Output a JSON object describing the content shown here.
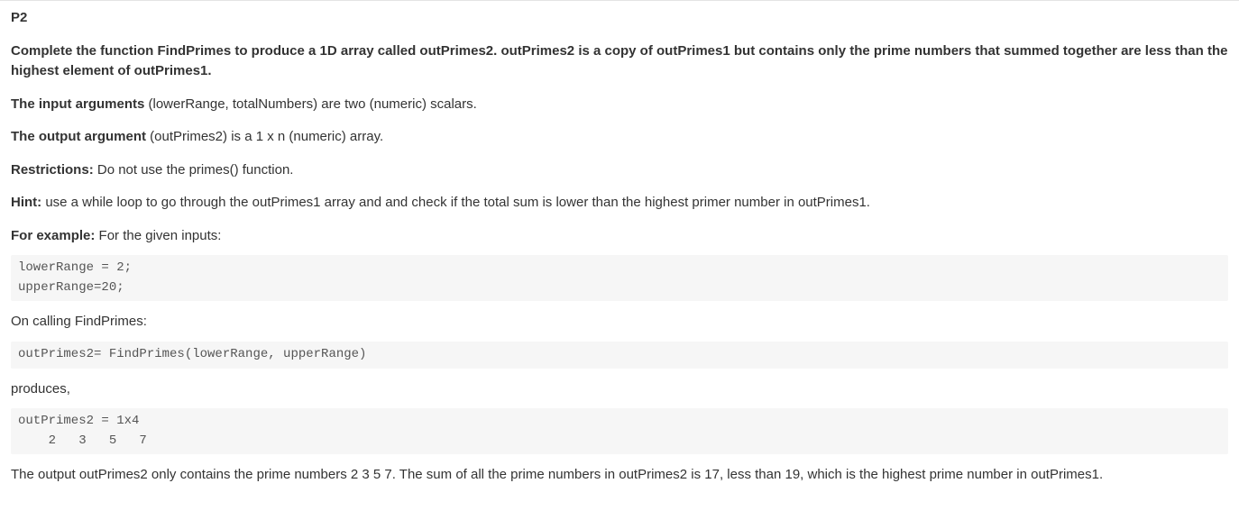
{
  "heading": "P2",
  "intro": {
    "bold": "Complete the function FindPrimes to produce a 1D array called outPrimes2.  outPrimes2 is a copy of outPrimes1 but contains only the prime numbers that summed together are less than the highest element of outPrimes1."
  },
  "input_args": {
    "label": "The input arguments",
    "rest": " (lowerRange, totalNumbers) are two (numeric) scalars."
  },
  "output_arg": {
    "label": "The output argument",
    "rest": " (outPrimes2) is a 1 x n (numeric) array."
  },
  "restrictions": {
    "label": "Restrictions:",
    "rest": " Do not use the primes() function."
  },
  "hint": {
    "label": "Hint:",
    "rest": " use a while loop to go through the outPrimes1 array and and check if the total sum is lower than the highest primer number in outPrimes1."
  },
  "example_label": {
    "label": "For example:",
    "rest": " For the given inputs:"
  },
  "code_inputs": "lowerRange = 2;\nupperRange=20;",
  "on_calling": "On calling FindPrimes:",
  "code_call": "outPrimes2= FindPrimes(lowerRange, upperRange)",
  "produces": "produces,",
  "code_output": "outPrimes2 = 1x4\n    2   3   5   7",
  "explanation": "The output outPrimes2 only contains the prime numbers 2 3 5 7. The sum of all the prime numbers in outPrimes2 is 17, less than 19, which is the highest prime number in outPrimes1."
}
